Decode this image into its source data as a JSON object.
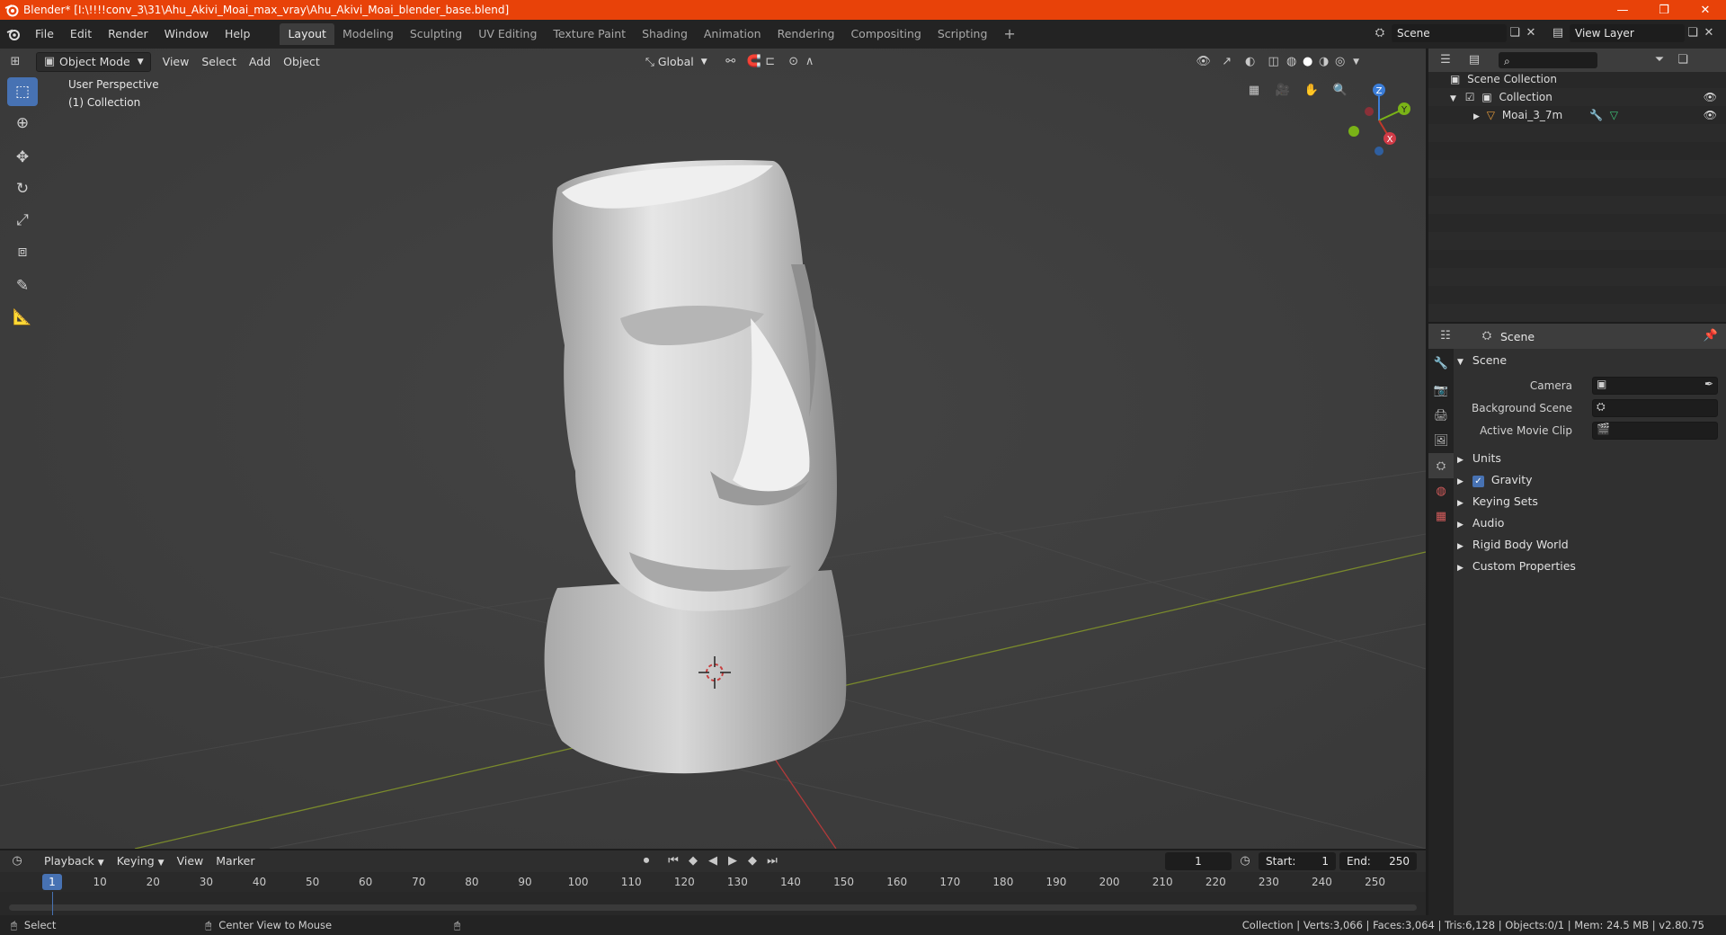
{
  "window": {
    "title": "Blender* [I:\\!!!!conv_3\\31\\Ahu_Akivi_Moai_max_vray\\Ahu_Akivi_Moai_blender_base.blend]",
    "min": "—",
    "restore": "❐",
    "close": "✕"
  },
  "menu": {
    "file": "File",
    "edit": "Edit",
    "render": "Render",
    "window": "Window",
    "help": "Help"
  },
  "workspaces": [
    "Layout",
    "Modeling",
    "Sculpting",
    "UV Editing",
    "Texture Paint",
    "Shading",
    "Animation",
    "Rendering",
    "Compositing",
    "Scripting"
  ],
  "scene_selector": {
    "label": "Scene"
  },
  "view_layer": {
    "label": "View Layer"
  },
  "viewport": {
    "mode": "Object Mode",
    "view": "View",
    "select": "Select",
    "add": "Add",
    "object": "Object",
    "orientation": "Global",
    "overlay_title": "User Perspective",
    "overlay_collection": "(1) Collection",
    "gizmo": {
      "z": "Z",
      "y": "Y",
      "x": "X"
    }
  },
  "outliner": {
    "scene_collection": "Scene Collection",
    "collection": "Collection",
    "object": "Moai_3_7m"
  },
  "properties": {
    "header": "Scene",
    "panel": "Scene",
    "camera_label": "Camera",
    "bg_scene_label": "Background Scene",
    "movie_clip_label": "Active Movie Clip",
    "sections": [
      "Units",
      "Gravity",
      "Keying Sets",
      "Audio",
      "Rigid Body World",
      "Custom Properties"
    ]
  },
  "timeline": {
    "playback": "Playback",
    "keying": "Keying",
    "view": "View",
    "marker": "Marker",
    "current_frame": "1",
    "start_label": "Start:",
    "start": "1",
    "end_label": "End:",
    "end": "250",
    "ruler_current": "1",
    "ticks": [
      "10",
      "20",
      "30",
      "40",
      "50",
      "60",
      "70",
      "80",
      "90",
      "100",
      "110",
      "120",
      "130",
      "140",
      "150",
      "160",
      "170",
      "180",
      "190",
      "200",
      "210",
      "220",
      "230",
      "240",
      "250"
    ]
  },
  "status": {
    "select": "Select",
    "center_view": "Center View to Mouse",
    "stats": "Collection | Verts:3,066 | Faces:3,064 | Tris:6,128 | Objects:0/1 | Mem: 24.5 MB | v2.80.75"
  },
  "colors": {
    "titlebar": "#e84209",
    "accent": "#4772b3",
    "viewport_bg": "#3c3c3c",
    "axis_x": "#c0392b",
    "axis_y": "#7ab317",
    "axis_z": "#3b7dd8"
  }
}
